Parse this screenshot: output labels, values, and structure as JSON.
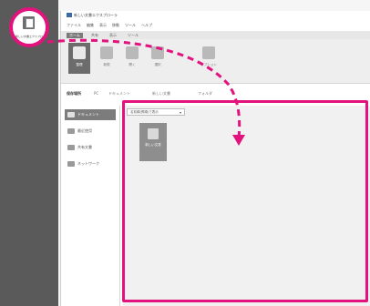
{
  "desktop": {
    "icon_name": "document-app-icon",
    "label": "新しい文書エクスプローラ"
  },
  "window": {
    "title": "新しい文書エクスプローラ",
    "menu": [
      "ファイル",
      "編集",
      "表示",
      "移動",
      "ツール",
      "ヘルプ"
    ],
    "ribbon_tabs": [
      "ホーム",
      "共有",
      "表示",
      "ツール"
    ],
    "ribbon_buttons": [
      {
        "label": "整理",
        "icon": "organize-icon"
      },
      {
        "label": "新規",
        "icon": "new-icon"
      },
      {
        "label": "開く",
        "icon": "open-icon"
      },
      {
        "label": "選択",
        "icon": "select-icon"
      },
      {
        "label": "オプション",
        "icon": "options-icon"
      }
    ],
    "breadcrumb": [
      "保存場所",
      "PC",
      "ドキュメント",
      "新しい文書",
      "フォルダ"
    ],
    "nav_items": [
      {
        "label": "ドキュメント",
        "icon": "folder-icon",
        "selected": true
      },
      {
        "label": "最近使用",
        "icon": "clock-icon",
        "selected": false
      },
      {
        "label": "共有文書",
        "icon": "share-icon",
        "selected": false
      },
      {
        "label": "ネットワーク",
        "icon": "network-icon",
        "selected": false
      }
    ],
    "sort_label": "名前順(昇順)で表示",
    "file_item": {
      "name": "新しい文書",
      "icon": "file-icon"
    }
  },
  "colors": {
    "accent": "#e2137d",
    "dark_panel": "#5a5a5a"
  }
}
